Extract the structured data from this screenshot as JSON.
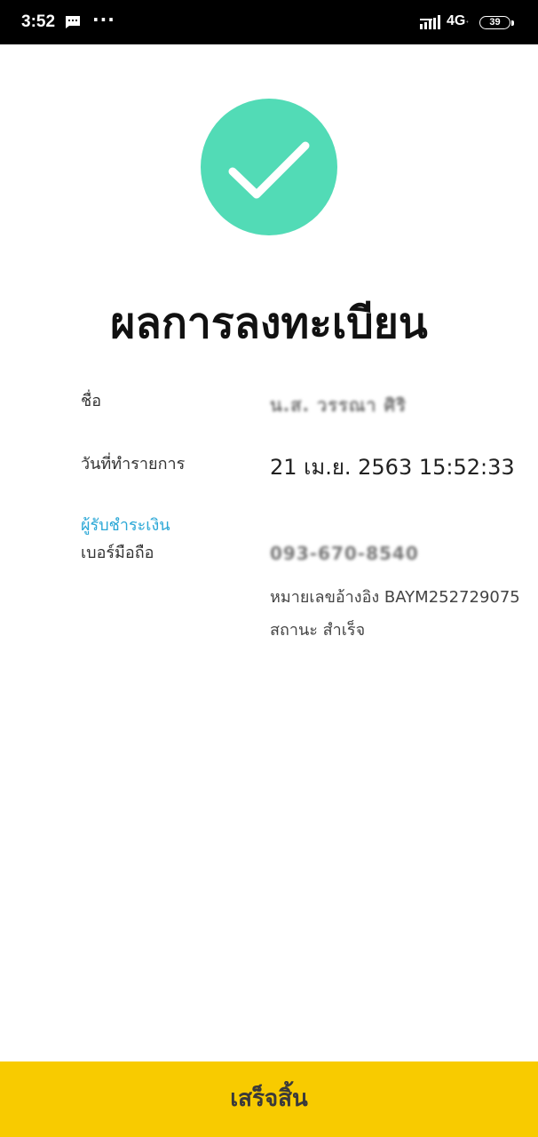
{
  "status_bar": {
    "time": "3:52",
    "dots": "···",
    "network": "4G",
    "network_sub": "⁺",
    "battery": "39"
  },
  "result": {
    "icon": "check-icon",
    "accent_color": "#52dbb6",
    "title": "ผลการลงทะเบียน"
  },
  "details": {
    "name_label": "ชื่อ",
    "name_value": "น.ส. วรรณา ศิริ",
    "date_label": "วันที่ทำรายการ",
    "date_value": "21 เม.ย. 2563 15:52:33",
    "payee_label": "ผู้รับชำระเงิน",
    "mobile_label": "เบอร์มือถือ",
    "mobile_value": "093-670-8540",
    "reference": "หมายเลขอ้างอิง BAYM252729075",
    "status": "สถานะ สำเร็จ"
  },
  "footer": {
    "done_label": "เสร็จสิ้น",
    "button_color": "#f8cb00"
  }
}
